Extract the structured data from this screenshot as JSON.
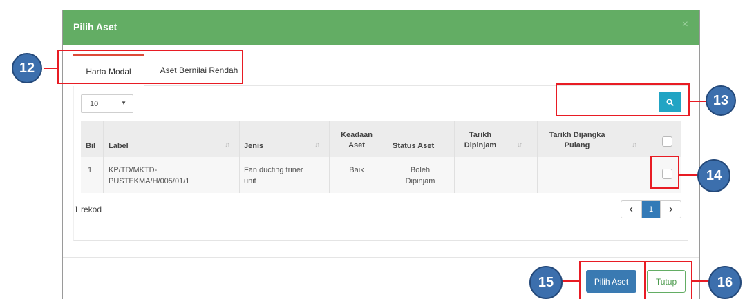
{
  "modal": {
    "title": "Pilih Aset",
    "close_symbol": "×"
  },
  "tabs": [
    {
      "label": "Harta Modal",
      "active": true
    },
    {
      "label": "Aset Bernilai Rendah",
      "active": false
    }
  ],
  "table_controls": {
    "page_length": "10",
    "search": {
      "value": "",
      "placeholder": ""
    }
  },
  "table": {
    "columns": [
      "Bil",
      "Label",
      "Jenis",
      "Keadaan Aset",
      "Status Aset",
      "Tarikh Dipinjam",
      "Tarikh Dijangka Pulang"
    ],
    "rows": [
      {
        "bil": "1",
        "label": "KP/TD/MKTD-PUSTEKMA/H/005/01/1",
        "jenis": "Fan ducting triner unit",
        "keadaan": "Baik",
        "status": "Boleh Dipinjam",
        "tarikh_dipinjam": "",
        "tarikh_pulang": "",
        "selected": false
      }
    ]
  },
  "footer_info": {
    "record_count": "1 rekod"
  },
  "pagination": {
    "prev": "‹",
    "current": "1",
    "next": "›"
  },
  "buttons": {
    "select": "Pilih Aset",
    "close": "Tutup"
  },
  "annotations": [
    {
      "label": "12"
    },
    {
      "label": "13"
    },
    {
      "label": "14"
    },
    {
      "label": "15"
    },
    {
      "label": "16"
    }
  ],
  "colors": {
    "header": "#63ad64",
    "primary": "#3a7ab2",
    "search_button": "#21a4c4",
    "active_tab_border": "#dd4b39",
    "callout": "#e81c24",
    "marker": "#3c6fad"
  }
}
